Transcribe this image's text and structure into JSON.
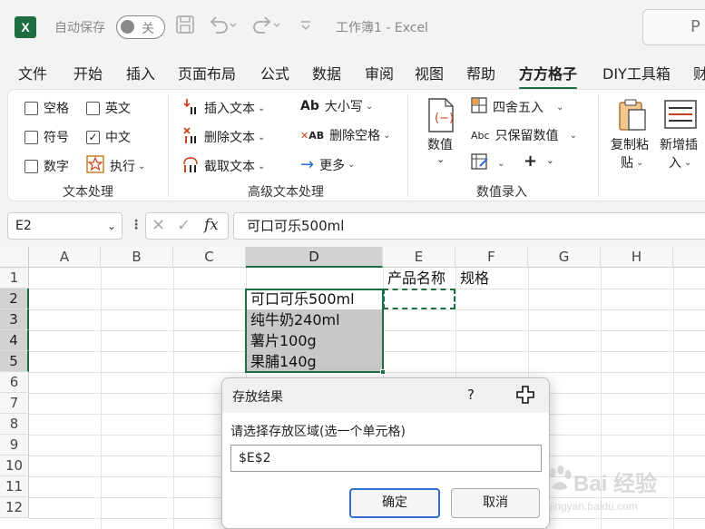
{
  "titlebar": {
    "app_letter": "X",
    "autosave_label": "自动保存",
    "autosave_state": "关",
    "doc_title": "工作簿1  -  Excel",
    "search_glyph": "P"
  },
  "tabs": [
    {
      "label": "文件"
    },
    {
      "label": "开始"
    },
    {
      "label": "插入"
    },
    {
      "label": "页面布局"
    },
    {
      "label": "公式"
    },
    {
      "label": "数据"
    },
    {
      "label": "审阅"
    },
    {
      "label": "视图"
    },
    {
      "label": "帮助"
    },
    {
      "label": "方方格子",
      "active": true
    },
    {
      "label": "DIY工具箱"
    },
    {
      "label": "财"
    }
  ],
  "ribbon": {
    "text_group": {
      "label": "文本处理",
      "items": [
        {
          "label": "空格",
          "checked": false
        },
        {
          "label": "英文",
          "checked": false
        },
        {
          "label": "符号",
          "checked": false
        },
        {
          "label": "中文",
          "checked": true
        },
        {
          "label": "数字",
          "checked": false
        },
        {
          "label": "执行"
        }
      ]
    },
    "adv_group": {
      "label": "高级文本处理",
      "items": [
        {
          "label": "插入文本"
        },
        {
          "label": "删除文本"
        },
        {
          "label": "截取文本"
        },
        {
          "label": "大小写"
        },
        {
          "label": "删除空格"
        },
        {
          "label": "更多"
        }
      ]
    },
    "num_group": {
      "label": "数值录入",
      "big_label_1": "数值",
      "items": [
        {
          "label": "四舍五入"
        },
        {
          "label": "只保留数值"
        }
      ],
      "abc_glyph": "Abc",
      "ab_glyph": "Ab",
      "ab2_glyph": "AB"
    },
    "copy_paste": {
      "line1": "复制粘",
      "line2": "贴"
    },
    "diy_insert": {
      "line1": "新增插",
      "line2": "入"
    }
  },
  "formula_bar": {
    "cell_ref": "E2",
    "fx": "fx",
    "content": "可口可乐500ml"
  },
  "grid": {
    "columns": [
      "A",
      "B",
      "C",
      "D",
      "E",
      "F",
      "G",
      "H"
    ],
    "rows": [
      "1",
      "2",
      "3",
      "4",
      "5",
      "6",
      "7",
      "8",
      "9",
      "10",
      "11",
      "12"
    ],
    "cells": {
      "E1": "产品名称",
      "F1": "规格",
      "D2": "可口可乐500ml",
      "D3": "纯牛奶240ml",
      "D4": "薯片100g",
      "D5": "果脯140g"
    }
  },
  "dialog": {
    "title": "存放结果",
    "help": "?",
    "prompt": "请选择存放区域(选一个单元格)",
    "value": "$E$2",
    "ok": "确定",
    "cancel": "取消"
  },
  "watermark": {
    "text": "Bai 经验",
    "sub": "jingyan.baidu.com"
  },
  "colors": {
    "accent": "#1d6f42",
    "ok_border": "#2e6fd1"
  }
}
